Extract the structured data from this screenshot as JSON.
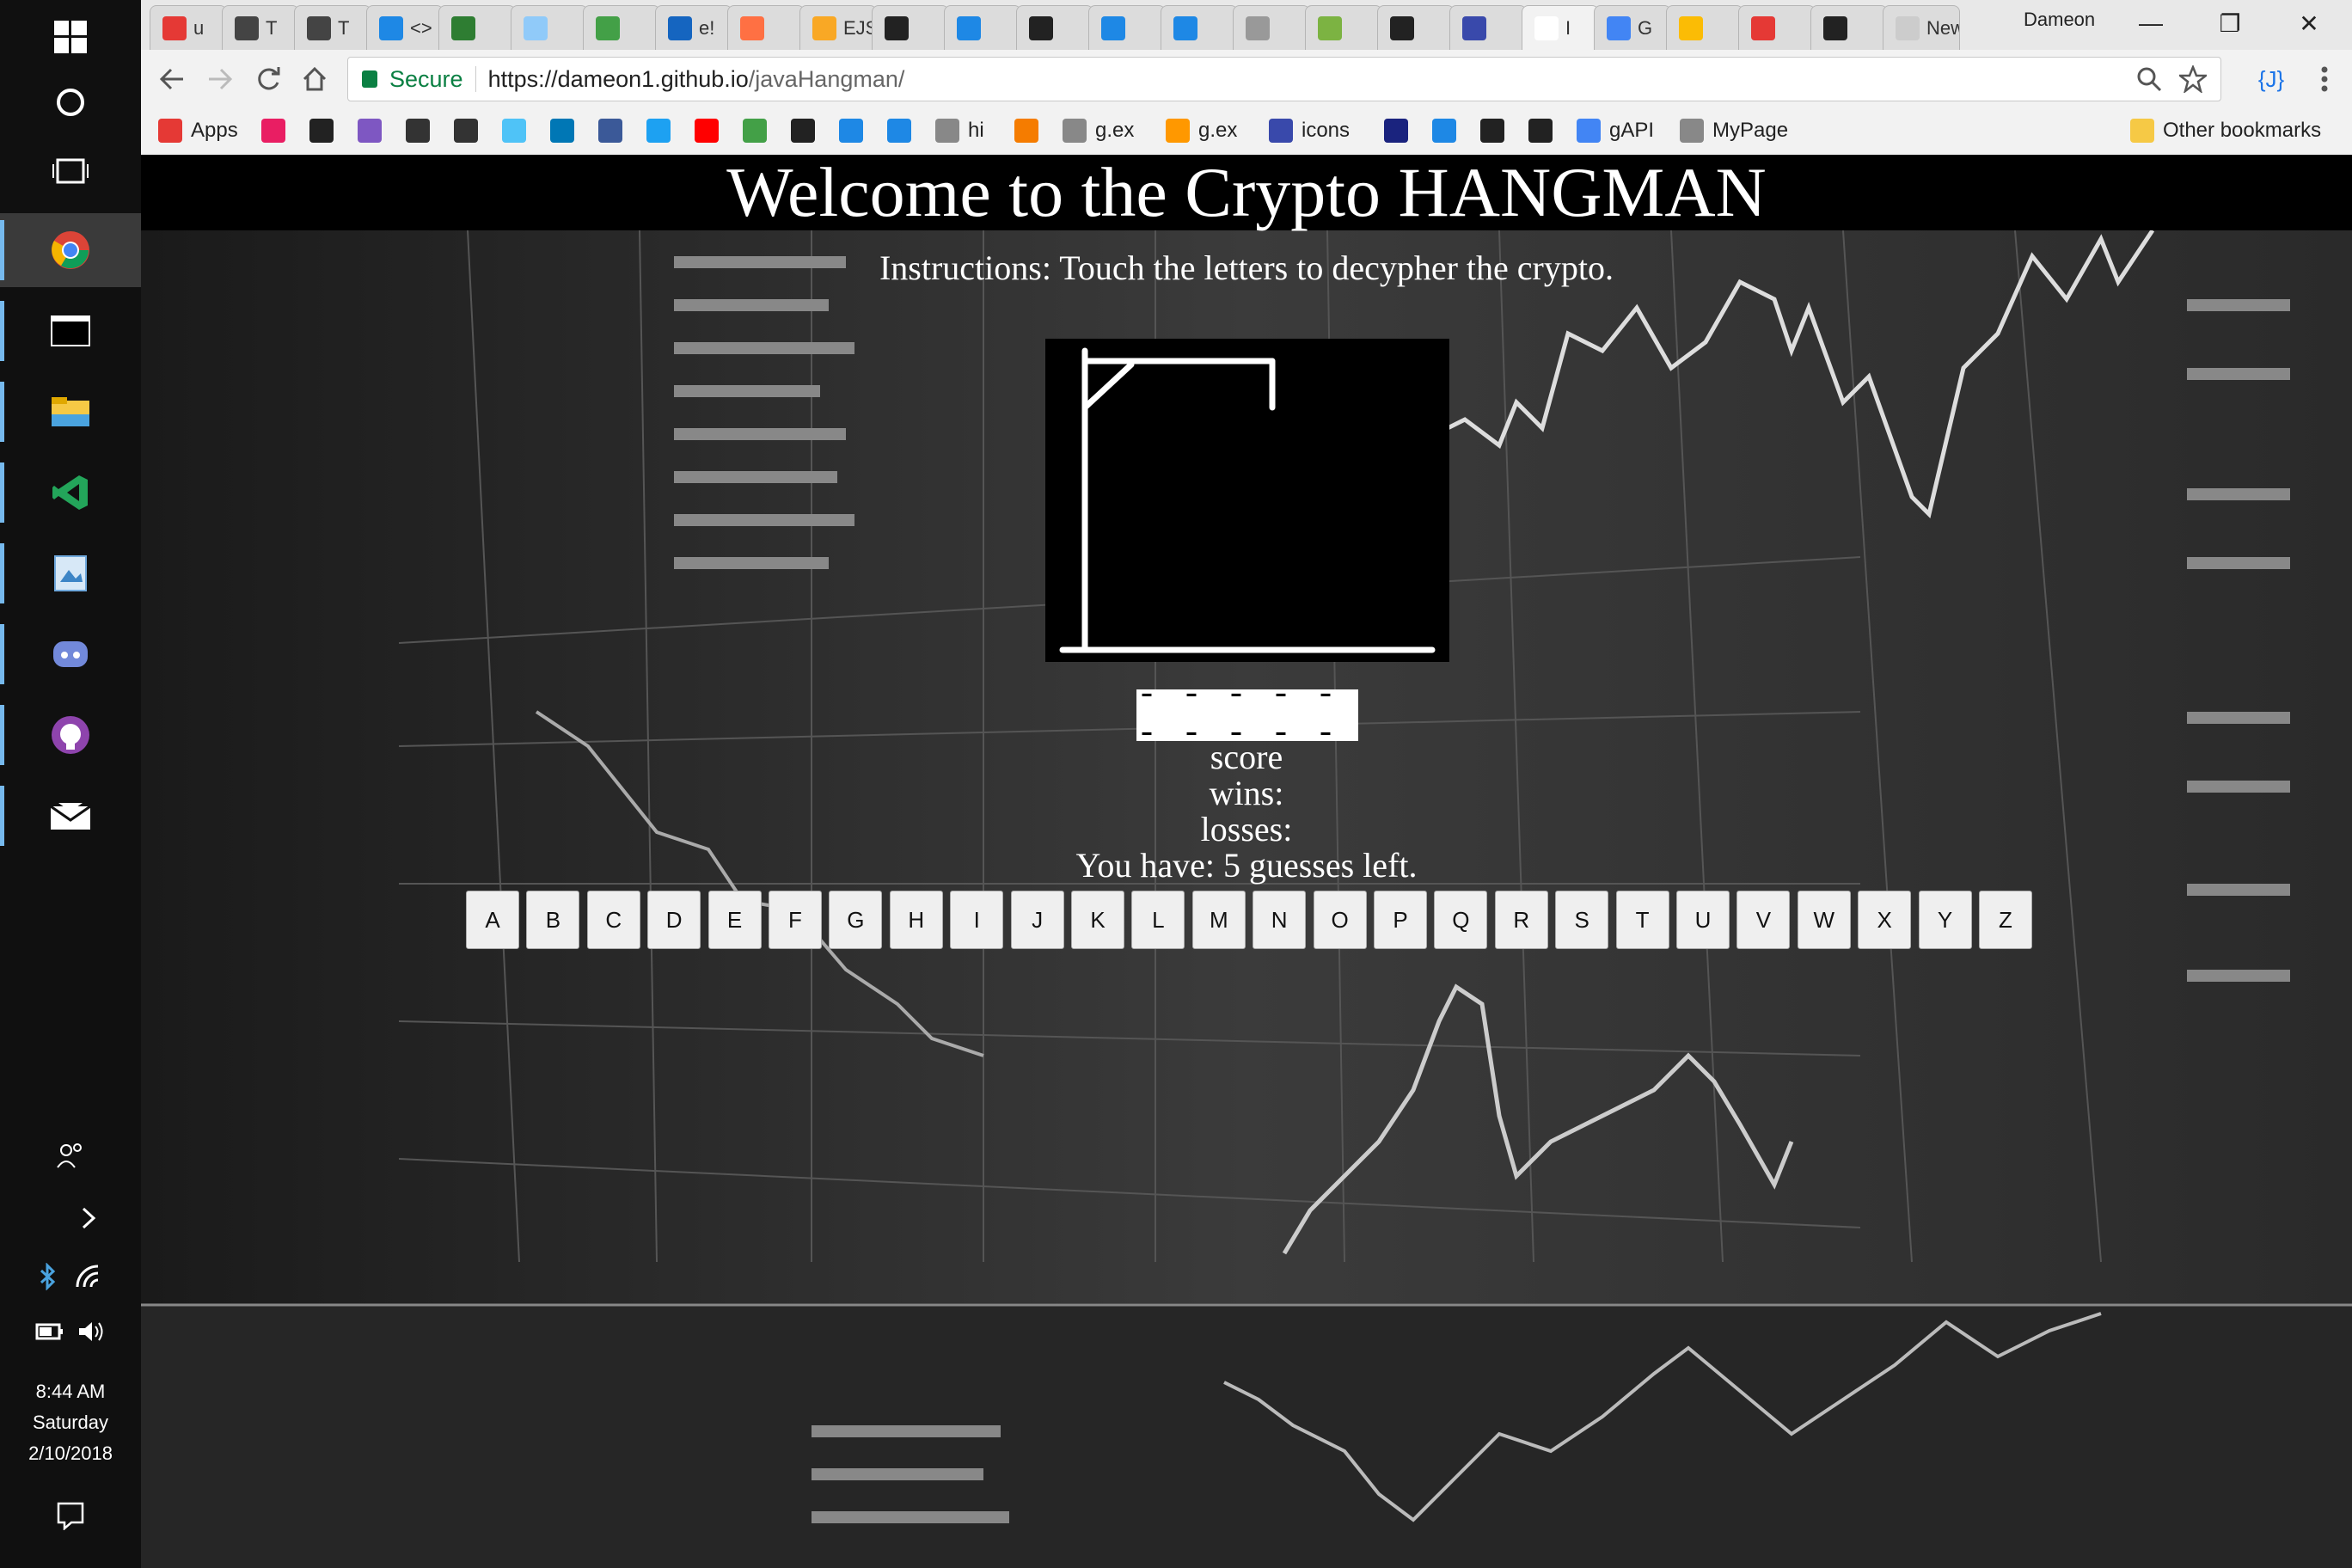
{
  "browser": {
    "tabs": [
      {
        "label": "u",
        "color": "#e53935"
      },
      {
        "label": "T",
        "color": "#444"
      },
      {
        "label": "T",
        "color": "#444"
      },
      {
        "label": "<>",
        "color": "#1e88e5"
      },
      {
        "label": "",
        "color": "#2e7d32"
      },
      {
        "label": "",
        "color": "#90caf9"
      },
      {
        "label": "",
        "color": "#43a047"
      },
      {
        "label": "e!",
        "color": "#1565c0"
      },
      {
        "label": "",
        "color": "#ff7043"
      },
      {
        "label": "EJS",
        "color": "#f9a825"
      },
      {
        "label": "",
        "color": "#222"
      },
      {
        "label": "",
        "color": "#1e88e5"
      },
      {
        "label": "",
        "color": "#222"
      },
      {
        "label": "",
        "color": "#1e88e5"
      },
      {
        "label": "",
        "color": "#1e88e5"
      },
      {
        "label": "",
        "color": "#999"
      },
      {
        "label": "",
        "color": "#7cb342"
      },
      {
        "label": "",
        "color": "#222"
      },
      {
        "label": "",
        "color": "#3949ab"
      },
      {
        "label": "I",
        "color": "#fff",
        "active": true
      },
      {
        "label": "G",
        "color": "#4285f4"
      },
      {
        "label": "",
        "color": "#fbbc05"
      },
      {
        "label": "",
        "color": "#e53935"
      },
      {
        "label": "",
        "color": "#222"
      },
      {
        "label": "New",
        "color": "#ccc"
      }
    ],
    "profile_name": "Dameon",
    "window_controls": {
      "minimize": "—",
      "restore": "❐",
      "close": "✕"
    },
    "secure_label": "Secure",
    "url_host": "https://dameon1.github.io",
    "url_path": "/javaHangman/",
    "extension_label": "{J}",
    "bookmarks": [
      {
        "label": "Apps",
        "color": "#e53935"
      },
      {
        "label": "",
        "color": "#e91e63"
      },
      {
        "label": "",
        "color": "#222"
      },
      {
        "label": "",
        "color": "#7e57c2"
      },
      {
        "label": "",
        "color": "#333"
      },
      {
        "label": "",
        "color": "#333"
      },
      {
        "label": "",
        "color": "#4fc3f7"
      },
      {
        "label": "",
        "color": "#0077b5"
      },
      {
        "label": "",
        "color": "#3b5998"
      },
      {
        "label": "",
        "color": "#1da1f2"
      },
      {
        "label": "",
        "color": "#ff0000"
      },
      {
        "label": "",
        "color": "#43a047"
      },
      {
        "label": "",
        "color": "#222"
      },
      {
        "label": "",
        "color": "#1e88e5"
      },
      {
        "label": "",
        "color": "#1e88e5"
      },
      {
        "label": "hi",
        "color": "#888"
      },
      {
        "label": "",
        "color": "#f57c00"
      },
      {
        "label": "g.ex",
        "color": "#888"
      },
      {
        "label": "g.ex",
        "color": "#ff9800"
      },
      {
        "label": "icons",
        "color": "#3949ab"
      },
      {
        "label": "",
        "color": "#1a237e"
      },
      {
        "label": "",
        "color": "#1e88e5"
      },
      {
        "label": "",
        "color": "#222"
      },
      {
        "label": "",
        "color": "#222"
      },
      {
        "label": "gAPI",
        "color": "#4285f4"
      },
      {
        "label": "MyPage",
        "color": "#888"
      }
    ],
    "other_bookmarks": "Other bookmarks"
  },
  "taskbar": {
    "time": "8:44 AM",
    "day": "Saturday",
    "date": "2/10/2018"
  },
  "page": {
    "title": "Welcome to the Crypto HANGMAN",
    "instructions": "Instructions: Touch the letters to decypher the crypto.",
    "word_display": "- - - - - - - - - -",
    "score_label": "score",
    "wins_label": "wins:",
    "losses_label": "losses:",
    "guesses_text": "You have: 5 guesses left.",
    "letters": [
      "A",
      "B",
      "C",
      "D",
      "E",
      "F",
      "G",
      "H",
      "I",
      "J",
      "K",
      "L",
      "M",
      "N",
      "O",
      "P",
      "Q",
      "R",
      "S",
      "T",
      "U",
      "V",
      "W",
      "X",
      "Y",
      "Z"
    ]
  }
}
